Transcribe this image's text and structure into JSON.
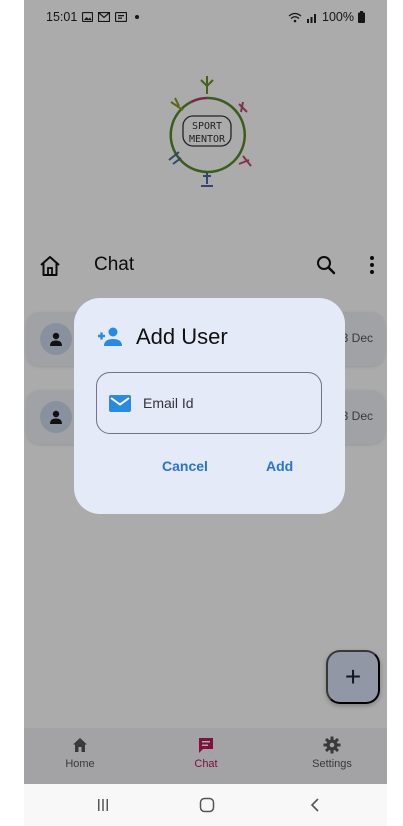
{
  "status_bar": {
    "time": "15:01",
    "battery": "100%"
  },
  "logo": {
    "line1": "SPORT",
    "line2": "MENTOR"
  },
  "header": {
    "title": "Chat"
  },
  "chats": [
    {
      "date": "3 Dec"
    },
    {
      "date": "3 Dec"
    }
  ],
  "dialog": {
    "title": "Add User",
    "email_placeholder": "Email Id",
    "email_value": "",
    "cancel_label": "Cancel",
    "add_label": "Add"
  },
  "fab": {
    "label": "+"
  },
  "bottom_nav": {
    "items": [
      {
        "label": "Home",
        "icon": "home-icon",
        "active": false
      },
      {
        "label": "Chat",
        "icon": "chat-icon",
        "active": true
      },
      {
        "label": "Settings",
        "icon": "gear-icon",
        "active": false
      }
    ]
  },
  "colors": {
    "accent": "#2a73d4",
    "active_nav": "#c2185b",
    "inactive_nav": "#555555",
    "dialog_bg": "#e4eaf7",
    "fab_bg": "#d9e2f7"
  }
}
